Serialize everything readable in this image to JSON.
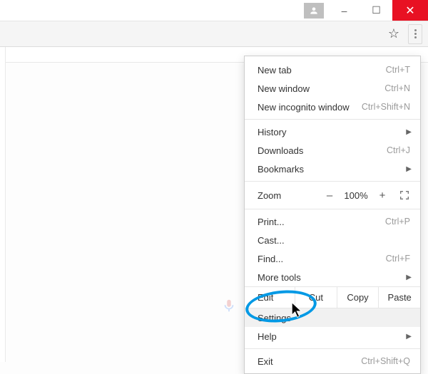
{
  "window": {
    "controls": {
      "minimize": "–",
      "maximize": "☐",
      "close": "✕"
    }
  },
  "menu": {
    "new_tab": {
      "label": "New tab",
      "accel": "Ctrl+T"
    },
    "new_window": {
      "label": "New window",
      "accel": "Ctrl+N"
    },
    "new_incognito": {
      "label": "New incognito window",
      "accel": "Ctrl+Shift+N"
    },
    "history": {
      "label": "History"
    },
    "downloads": {
      "label": "Downloads",
      "accel": "Ctrl+J"
    },
    "bookmarks": {
      "label": "Bookmarks"
    },
    "zoom": {
      "label": "Zoom",
      "minus": "–",
      "value": "100%",
      "plus": "+"
    },
    "print": {
      "label": "Print...",
      "accel": "Ctrl+P"
    },
    "cast": {
      "label": "Cast..."
    },
    "find": {
      "label": "Find...",
      "accel": "Ctrl+F"
    },
    "more_tools": {
      "label": "More tools"
    },
    "edit": {
      "label": "Edit",
      "cut": "Cut",
      "copy": "Copy",
      "paste": "Paste"
    },
    "settings": {
      "label": "Settings"
    },
    "help": {
      "label": "Help"
    },
    "exit": {
      "label": "Exit",
      "accel": "Ctrl+Shift+Q"
    }
  }
}
